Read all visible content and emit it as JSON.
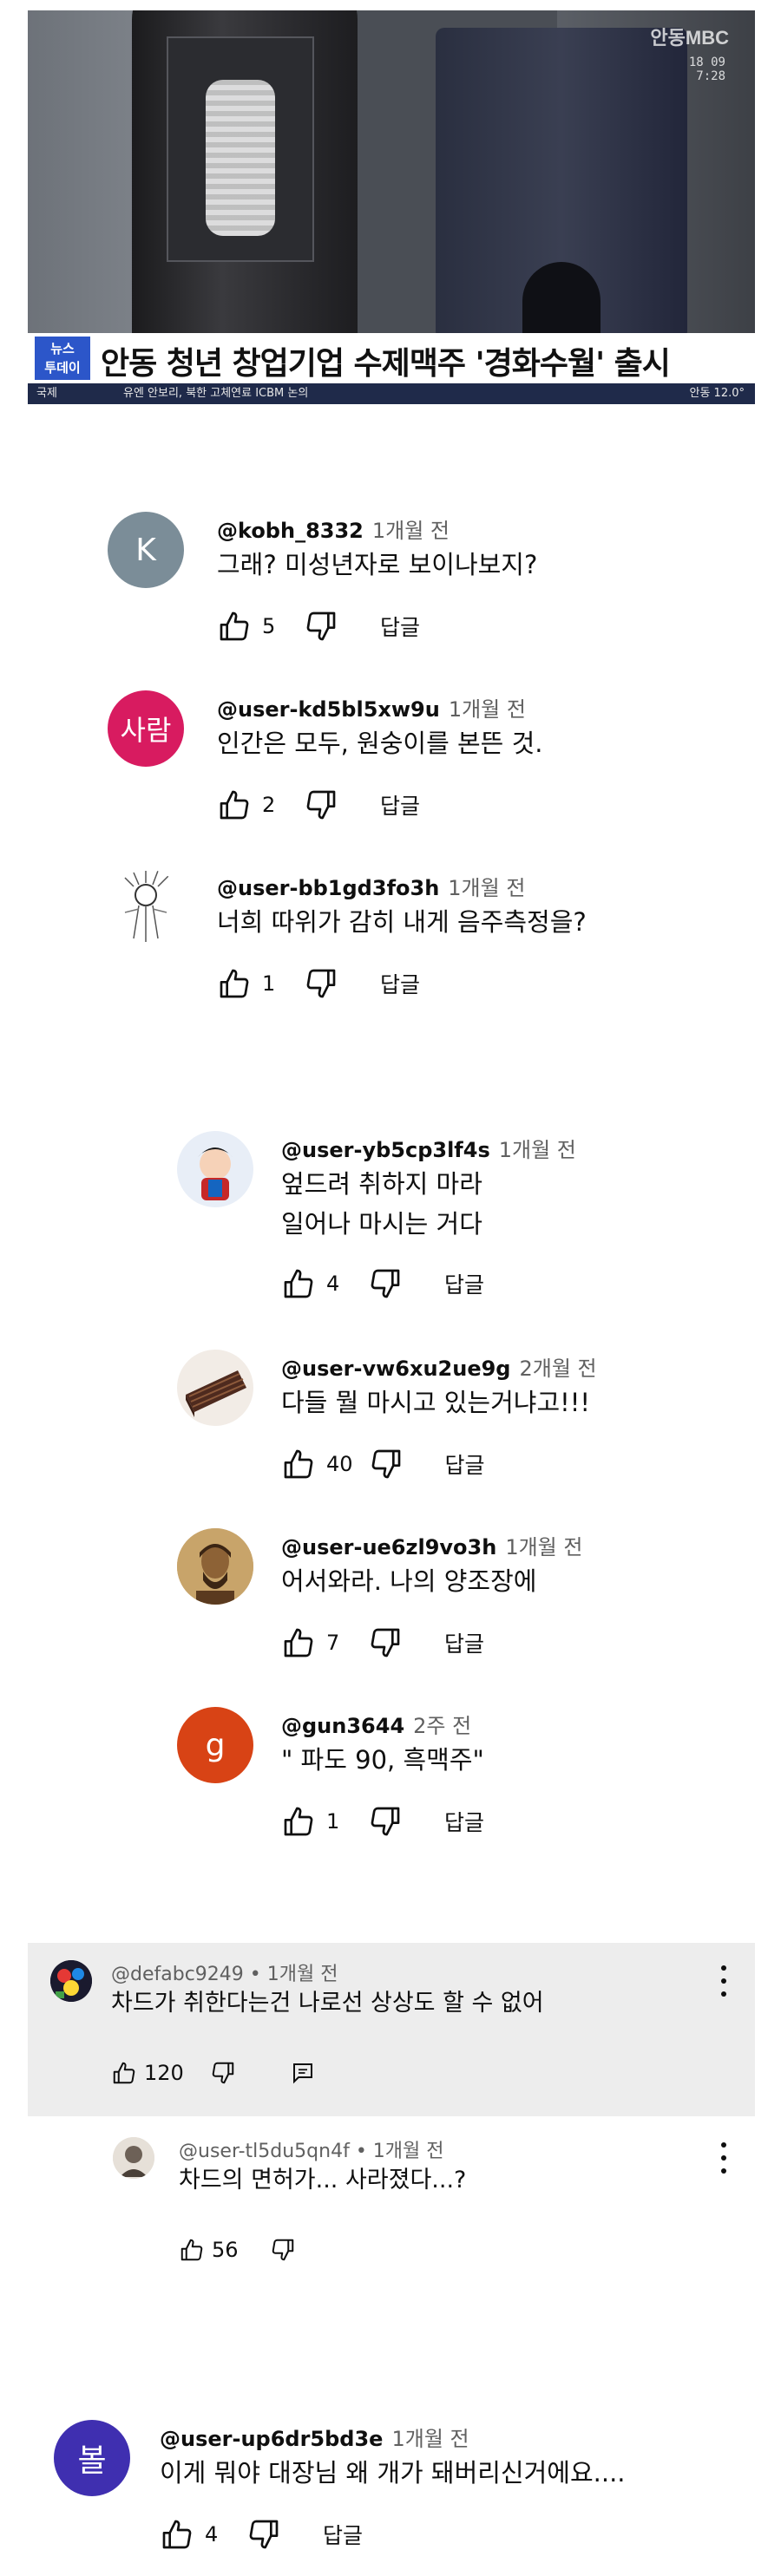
{
  "video": {
    "badge": "뉴스\n투데이",
    "headline": "안동 청년 창업기업 수제맥주 '경화수월' 출시",
    "ticker_category": "국제",
    "ticker_text": "유엔 안보리, 북한 고체연료 ICBM 논의",
    "ticker_right": "안동  12.0°",
    "watermark": "안동MBC",
    "watermark_time": "18 09\n7:28"
  },
  "comments": [
    {
      "author": "@kobh_8332",
      "time": "1개월 전",
      "text": [
        "그래? 미성년자로 보이나보지?"
      ],
      "likes": "5",
      "reply": "답글",
      "avatar_letter": "K",
      "avatar_color": "#7b8d98"
    },
    {
      "author": "@user-kd5bl5xw9u",
      "time": "1개월 전",
      "text": [
        "인간은 모두, 원숭이를 본뜬 것."
      ],
      "likes": "2",
      "reply": "답글",
      "avatar_letter": "사람",
      "avatar_color": "#d81b60"
    },
    {
      "author": "@user-bb1gd3fo3h",
      "time": "1개월 전",
      "text": [
        "너희 따위가 감히 내게 음주측정을?"
      ],
      "likes": "1",
      "reply": "답글",
      "avatar_letter": "",
      "avatar_color": "#ffffff"
    }
  ],
  "replies": [
    {
      "author": "@user-yb5cp3lf4s",
      "time": "1개월 전",
      "text": [
        "엎드려 취하지 마라",
        "일어나 마시는 거다"
      ],
      "likes": "4",
      "reply": "답글",
      "avatar_color": "#e8eef7"
    },
    {
      "author": "@user-vw6xu2ue9g",
      "time": "2개월 전",
      "text": [
        "다들 뭘 마시고 있는거냐고!!!"
      ],
      "likes": "40",
      "reply": "답글",
      "avatar_color": "#f2ece6"
    },
    {
      "author": "@user-ue6zl9vo3h",
      "time": "1개월 전",
      "text": [
        "어서와라. 나의 양조장에"
      ],
      "likes": "7",
      "reply": "답글",
      "avatar_color": "#c8a46a"
    },
    {
      "author": "@gun3644",
      "time": "2주 전",
      "text": [
        "\" 파도 90, 흑맥주\""
      ],
      "likes": "1",
      "reply": "답글",
      "avatar_letter": "g",
      "avatar_color": "#d84315"
    }
  ],
  "highlighted": {
    "author": "@defabc9249",
    "separator": "•",
    "time": "1개월 전",
    "text": "차드가 취한다는건 나로선 상상도 할 수 없어",
    "likes": "120"
  },
  "highlighted_reply": {
    "author": "@user-tl5du5qn4f",
    "separator": "•",
    "time": "1개월 전",
    "text": "차드의 면허가... 사라졌다...?",
    "likes": "56"
  },
  "last_comment": {
    "author": "@user-up6dr5bd3e",
    "time": "1개월 전",
    "text": "이게 뭐야 대장님 왜 개가 돼버리신거에요....",
    "likes": "4",
    "reply": "답글",
    "avatar_letter": "볼",
    "avatar_color": "#3f2fb0"
  }
}
